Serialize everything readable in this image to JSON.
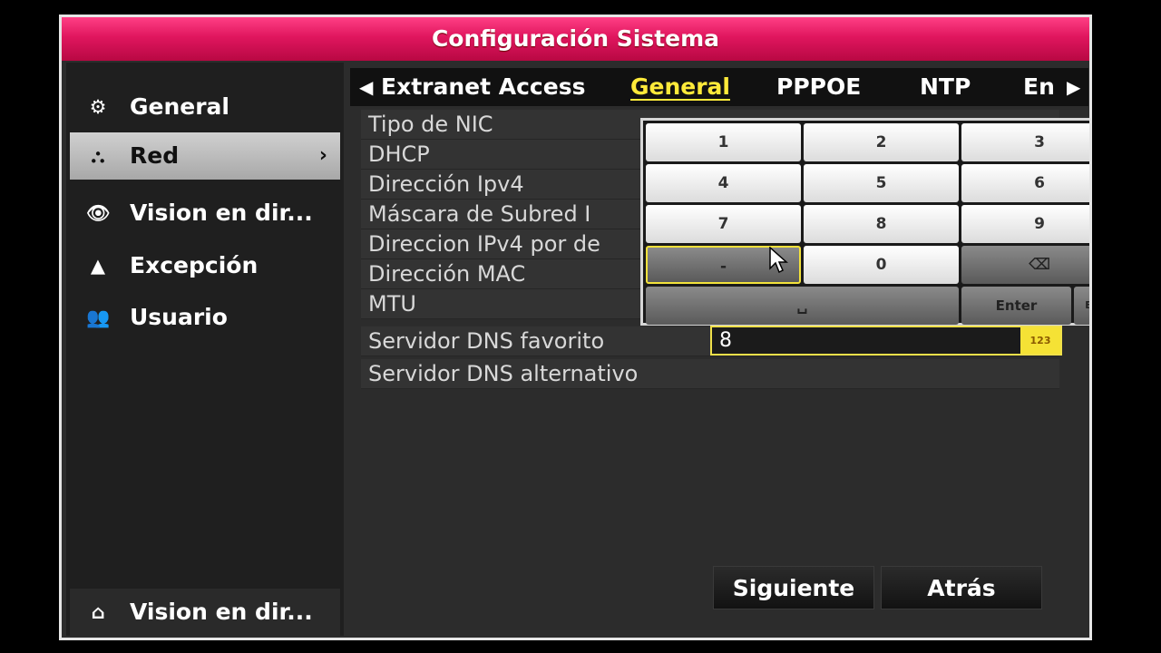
{
  "window": {
    "title": "Configuración Sistema"
  },
  "sidebar": {
    "items": [
      {
        "label": "General",
        "icon": "gear-icon"
      },
      {
        "label": "Red",
        "icon": "network-icon"
      },
      {
        "label": "Vision en dir...",
        "icon": "eye-icon"
      },
      {
        "label": "Excepción",
        "icon": "warning-icon"
      },
      {
        "label": "Usuario",
        "icon": "users-icon"
      }
    ],
    "bottom": {
      "label": "Vision en dir...",
      "icon": "home-icon"
    }
  },
  "tabs": [
    {
      "label": "Extranet Access"
    },
    {
      "label": "General"
    },
    {
      "label": "PPPOE"
    },
    {
      "label": "NTP"
    },
    {
      "label": "En"
    }
  ],
  "active_tab": "General",
  "form": {
    "rows": [
      {
        "label": "Tipo de NIC"
      },
      {
        "label": "DHCP"
      },
      {
        "label": "Dirección Ipv4"
      },
      {
        "label": "Máscara de Subred I"
      },
      {
        "label": "Direccion IPv4 por de"
      },
      {
        "label": "Dirección MAC"
      },
      {
        "label": "MTU"
      },
      {
        "label": "Servidor DNS favorito"
      },
      {
        "label": "Servidor DNS alternativo"
      }
    ],
    "dns_value": "8",
    "input_mode": "123"
  },
  "keypad": {
    "keys": [
      "1",
      "2",
      "3",
      "4",
      "5",
      "6",
      "7",
      "8",
      "9",
      "-",
      "0"
    ],
    "enter_label": "Enter",
    "esc_label": "ESC",
    "selected_key": "-"
  },
  "buttons": {
    "next": "Siguiente",
    "back": "Atrás"
  },
  "colors": {
    "title_bar": "#e0165e",
    "highlight": "#f3e23b"
  }
}
